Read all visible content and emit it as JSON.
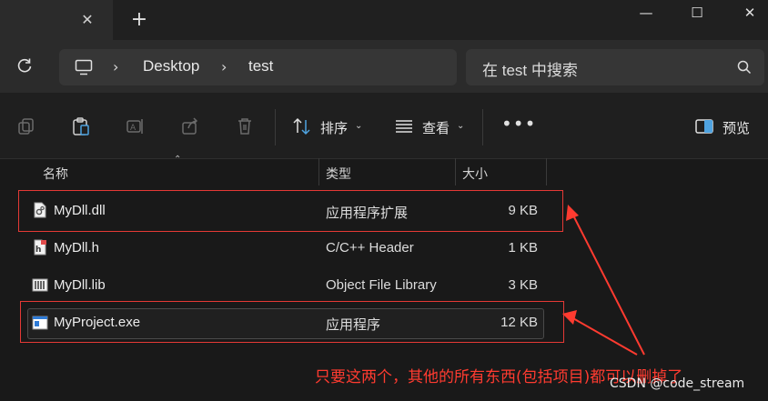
{
  "window": {
    "tab_close": "✕",
    "new_tab": "+",
    "minimize": "—",
    "maximize": "☐",
    "close": "✕"
  },
  "nav": {
    "refresh_icon": "refresh-icon",
    "breadcrumbs": [
      "Desktop",
      "test"
    ],
    "search_placeholder": "在 test 中搜索"
  },
  "toolbar": {
    "sort_label": "排序",
    "view_label": "查看",
    "more_label": "•••",
    "preview_label": "预览"
  },
  "columns": {
    "name": "名称",
    "type": "类型",
    "size": "大小"
  },
  "files": [
    {
      "name": "MyDll.dll",
      "type": "应用程序扩展",
      "size": "9 KB",
      "icon": "dll-file-icon"
    },
    {
      "name": "MyDll.h",
      "type": "C/C++ Header",
      "size": "1 KB",
      "icon": "header-file-icon"
    },
    {
      "name": "MyDll.lib",
      "type": "Object File Library",
      "size": "3 KB",
      "icon": "lib-file-icon"
    },
    {
      "name": "MyProject.exe",
      "type": "应用程序",
      "size": "12 KB",
      "icon": "exe-file-icon"
    }
  ],
  "annotation": {
    "text": "只要这两个，其他的所有东西(包括项目)都可以删掉了",
    "color": "#ff3b30"
  },
  "watermark": "CSDN @code_stream"
}
